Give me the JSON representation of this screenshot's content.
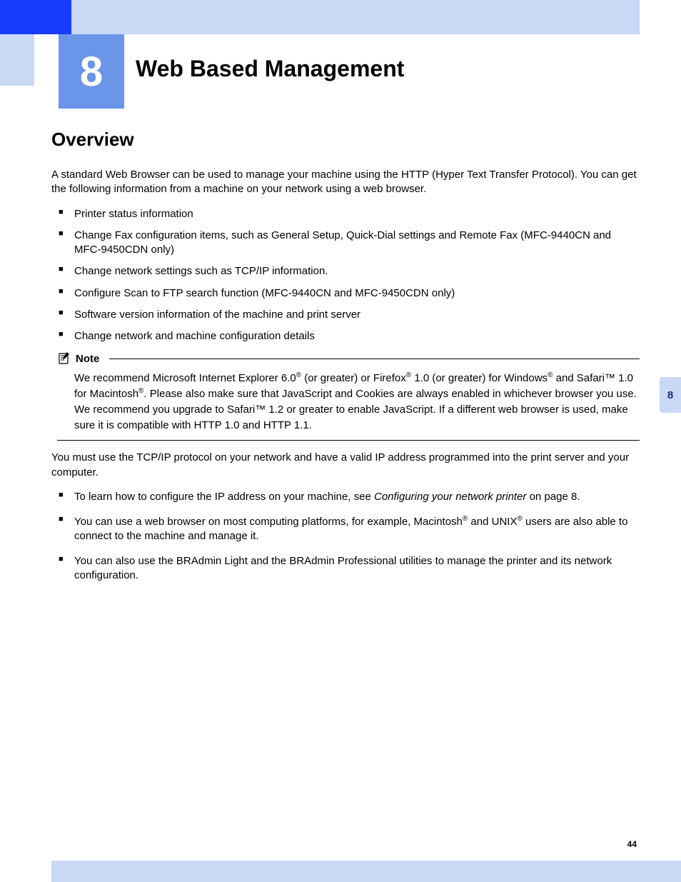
{
  "chapter": {
    "number": "8",
    "title": "Web Based Management"
  },
  "overview": {
    "heading": "Overview",
    "intro": "A standard Web Browser can be used to manage your machine using the HTTP (Hyper Text Transfer Protocol). You can get the following information from a machine on your network using a web browser.",
    "bullets1": [
      "Printer status information",
      "Change Fax configuration items, such as General Setup, Quick-Dial settings and Remote Fax (MFC-9440CN and MFC-9450CDN only)",
      "Change network settings such as TCP/IP information.",
      "Configure Scan to FTP search function (MFC-9440CN and MFC-9450CDN only)",
      "Software version information of the machine and print server",
      "Change network and machine configuration details"
    ]
  },
  "note": {
    "label": "Note",
    "text_parts": {
      "p1": "We recommend Microsoft Internet Explorer 6.0",
      "p2": " (or greater) or Firefox",
      "p3": " 1.0 (or greater) for Windows",
      "p4": " and Safari™ 1.0 for Macintosh",
      "p5": ". Please also make sure that JavaScript and Cookies are always enabled in whichever browser you use. We recommend you upgrade to Safari™ 1.2 or greater to enable JavaScript. If a different web browser is used, make sure it is compatible with HTTP 1.0 and HTTP 1.1.",
      "reg": "®"
    }
  },
  "post": {
    "para": "You must use the TCP/IP protocol on your network and have a valid IP address programmed into the print server and your computer.",
    "bullet2_a_pre": "To learn how to configure the IP address on your machine, see ",
    "bullet2_a_link": "Configuring your network printer",
    "bullet2_a_post": " on page 8.",
    "bullet2_b_pre": "You can use a web browser on most computing platforms, for example, Macintosh",
    "bullet2_b_mid": " and UNIX",
    "bullet2_b_post": " users are also able to connect to the machine and manage it.",
    "bullet2_c": "You can also use the BRAdmin Light and the BRAdmin Professional utilities to manage the printer and its network configuration.",
    "reg": "®"
  },
  "side_tab": "8",
  "page_number": "44"
}
